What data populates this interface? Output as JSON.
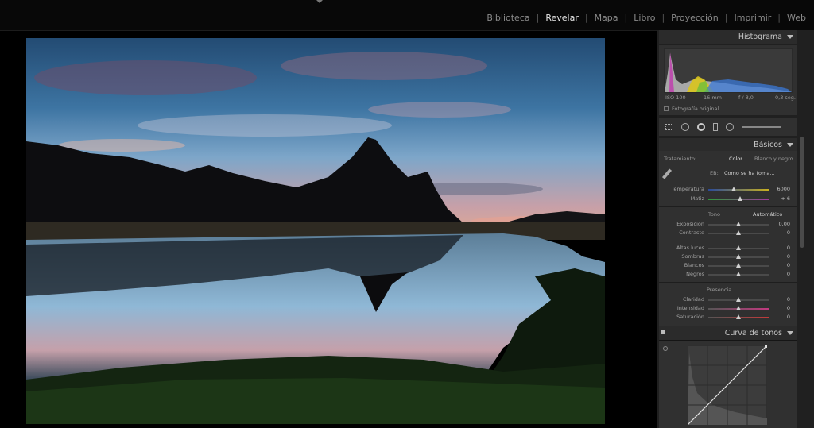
{
  "modules": [
    {
      "label": "Biblioteca",
      "active": false
    },
    {
      "label": "Revelar",
      "active": true
    },
    {
      "label": "Mapa",
      "active": false
    },
    {
      "label": "Libro",
      "active": false
    },
    {
      "label": "Proyección",
      "active": false
    },
    {
      "label": "Imprimir",
      "active": false
    },
    {
      "label": "Web",
      "active": false
    }
  ],
  "histogram": {
    "title": "Histograma",
    "iso": "ISO 100",
    "focal": "16 mm",
    "aperture": "f / 8,0",
    "shutter": "0,3 seg.",
    "original_label": "Fotografía original"
  },
  "basics": {
    "title": "Básicos",
    "treatment_label": "Tratamiento:",
    "treatment_color": "Color",
    "treatment_bw": "Blanco y negro",
    "wb_label": "EB:",
    "wb_value": "Como se ha toma...",
    "temperature": {
      "label": "Temperatura",
      "value": "6000",
      "pos": 0.42
    },
    "tint": {
      "label": "Matiz",
      "value": "+ 6",
      "pos": 0.52
    },
    "tone_label": "Tono",
    "auto_label": "Automático",
    "exposure": {
      "label": "Exposición",
      "value": "0,00",
      "pos": 0.5
    },
    "contrast": {
      "label": "Contraste",
      "value": "0",
      "pos": 0.5
    },
    "highlights": {
      "label": "Altas luces",
      "value": "0",
      "pos": 0.5
    },
    "shadows": {
      "label": "Sombras",
      "value": "0",
      "pos": 0.5
    },
    "whites": {
      "label": "Blancos",
      "value": "0",
      "pos": 0.5
    },
    "blacks": {
      "label": "Negros",
      "value": "0",
      "pos": 0.5
    },
    "presence_label": "Presencia",
    "clarity": {
      "label": "Claridad",
      "value": "0",
      "pos": 0.5
    },
    "vibrance": {
      "label": "Intensidad",
      "value": "0",
      "pos": 0.5
    },
    "saturation": {
      "label": "Saturación",
      "value": "0",
      "pos": 0.5
    }
  },
  "curve": {
    "title": "Curva de tonos"
  },
  "colors": {
    "accent": "#e6e6e6",
    "panel": "#303030",
    "header": "#2b2b2b"
  }
}
